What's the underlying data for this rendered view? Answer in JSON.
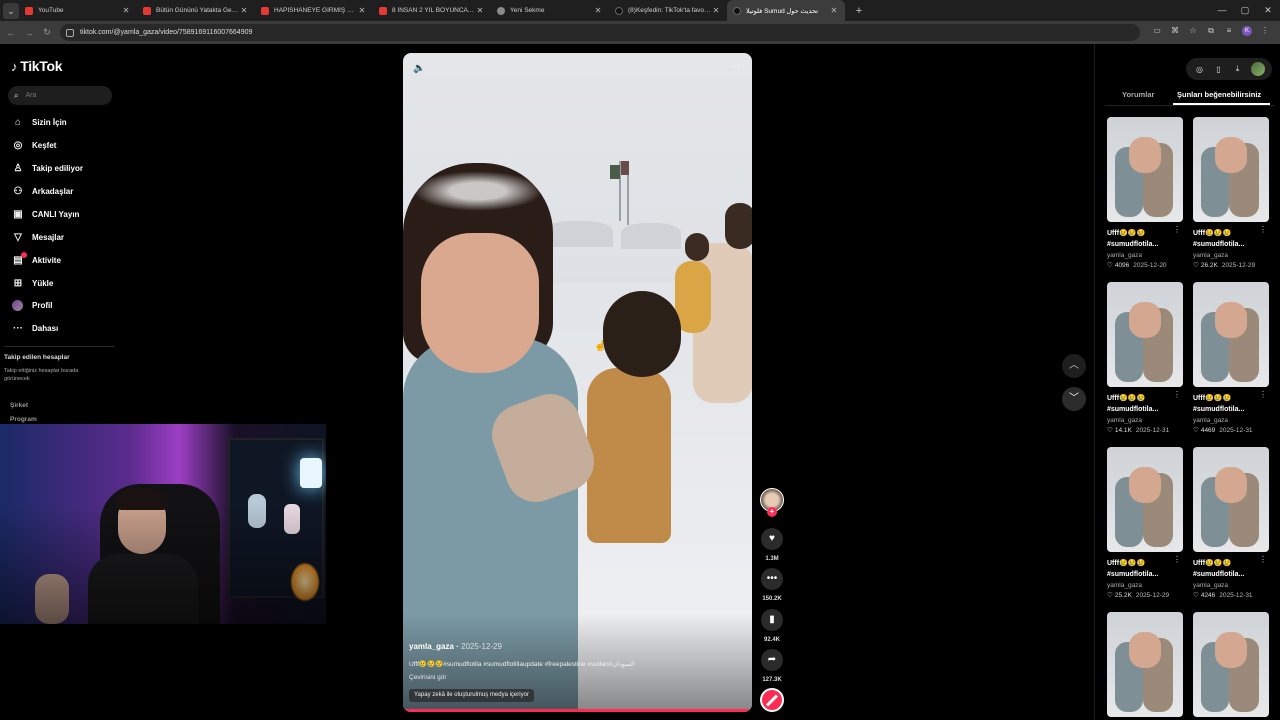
{
  "browser": {
    "tabs": [
      {
        "label": "YouTube",
        "favicon": "youtube-icon",
        "active": false
      },
      {
        "label": "Bütün Gününü Yatakta Geçiriyo",
        "favicon": "youtube-icon",
        "active": false
      },
      {
        "label": "HAPİSHANEYE GİRMİŞ HANIMI",
        "favicon": "youtube-icon",
        "active": false
      },
      {
        "label": "8 İNSAN 2 YIL BOYUNCA BİR M",
        "favicon": "youtube-icon",
        "active": false
      },
      {
        "label": "Yeni Sekme",
        "favicon": "newtab-icon",
        "active": false
      },
      {
        "label": "(8)Keşfedin: TikTok'ta favori vid",
        "favicon": "tiktok-icon",
        "active": false
      },
      {
        "label": "فلوتيلا Sumud تحديث حول",
        "favicon": "tiktok-icon",
        "active": true
      }
    ],
    "url": "tiktok.com/@yamla_gaza/video/7589169116007664909",
    "profile_initial": "K"
  },
  "tiktok": {
    "logo": "TikTok",
    "search_placeholder": "Ara",
    "nav": [
      {
        "label": "Sizin İçin",
        "icon": "home-icon"
      },
      {
        "label": "Keşfet",
        "icon": "compass-icon"
      },
      {
        "label": "Takip ediliyor",
        "icon": "following-icon"
      },
      {
        "label": "Arkadaşlar",
        "icon": "friends-icon"
      },
      {
        "label": "CANLI Yayın",
        "icon": "live-icon"
      },
      {
        "label": "Mesajlar",
        "icon": "messages-icon"
      },
      {
        "label": "Aktivite",
        "icon": "activity-icon"
      },
      {
        "label": "Yükle",
        "icon": "upload-icon"
      },
      {
        "label": "Profil",
        "icon": "profile-avatar"
      },
      {
        "label": "Dahası",
        "icon": "more-icon"
      }
    ],
    "followed_title": "Takip edilen hesaplar",
    "followed_desc": "Takip ettiğiniz hesaplar burada görünecek",
    "footer_links": [
      "Şirket",
      "Program"
    ]
  },
  "video": {
    "author": "yamla_gaza",
    "date": "2025-12-29",
    "caption": "Ufff😢😢😢#sumudflotila #sumudflotillaupdate #freepalestine #sudan#السودان",
    "translate_label": "Çevirisini gör",
    "ai_label": "Yapay zekâ ile oluşturulmuş medya içeriyor",
    "progress": 1.0
  },
  "actions": {
    "likes": "1.3M",
    "comments": "150.2K",
    "saves": "92.4K",
    "shares": "127.3K"
  },
  "right_panel": {
    "tabs": [
      "Yorumlar",
      "Şunları beğenebilirsiniz"
    ],
    "active_tab": 1,
    "cards": [
      {
        "title1": "Ufff😢😢😢",
        "title2": "#sumudflotila...",
        "user": "yamla_gaza",
        "likes": "4096",
        "date": "2025-12-20"
      },
      {
        "title1": "Ufff😢😢😢",
        "title2": "#sumudflotila...",
        "user": "yamla_gaza",
        "likes": "26.2K",
        "date": "2025-12-29"
      },
      {
        "title1": "Ufff😢😢😢",
        "title2": "#sumudflotila...",
        "user": "yamla_gaza",
        "likes": "14.1K",
        "date": "2025-12-31"
      },
      {
        "title1": "Ufff😢😢😢",
        "title2": "#sumudflotila...",
        "user": "yamla_gaza",
        "likes": "4469",
        "date": "2025-12-31"
      },
      {
        "title1": "Ufff😢😢😢",
        "title2": "#sumudflotila...",
        "user": "yamla_gaza",
        "likes": "25.2K",
        "date": "2025-12-29"
      },
      {
        "title1": "Ufff😢😢😢",
        "title2": "#sumudflotila...",
        "user": "yamla_gaza",
        "likes": "4246",
        "date": "2025-12-31"
      }
    ]
  },
  "colors": {
    "accent": "#fe2c55",
    "background": "#000000"
  }
}
